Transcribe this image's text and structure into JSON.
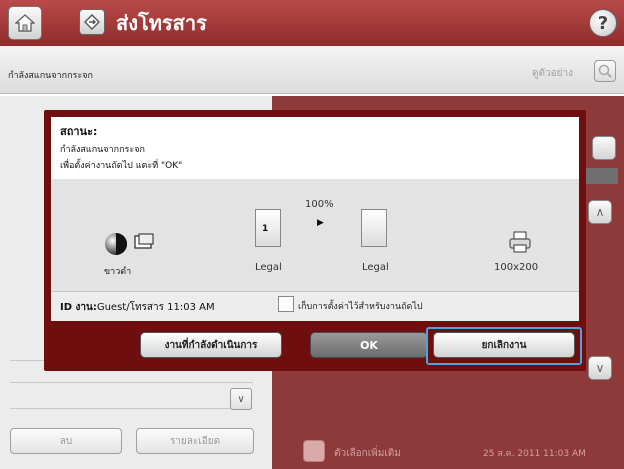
{
  "header": {
    "title": "ส่งโทรสาร",
    "home_icon": "home-icon",
    "fax_icon": "fax-send-icon",
    "help_icon": "help-icon",
    "help_glyph": "?"
  },
  "statusbar": {
    "status": "กำลังสแกนจากกระจก",
    "preview_label": "ดูตัวอย่าง"
  },
  "background": {
    "delete_label": "ลบ",
    "details_label": "รายละเอียด",
    "more_options_label": "ตัวเลือกเพิ่มเติม",
    "datetime": "25 ส.ค. 2011 11:03 AM"
  },
  "dialog": {
    "status_heading": "สถานะ:",
    "status_line1": "กำลังสแกนจากกระจก",
    "status_line2": "เพื่อตั้งค่างานถัดไป แตะที่ \"OK\"",
    "color_label": "ขาวดำ",
    "zoom_label": "100%",
    "page_number": "1",
    "original_size": "Legal",
    "output_size": "Legal",
    "paper_size": "100x200",
    "job_id_label": "ID งาน:",
    "job_id_value": "Guest/โทรสาร 11:03 AM",
    "keep_settings_label": "เก็บการตั้งค่าไว้สำหรับงานถัดไป",
    "keep_settings_checked": false,
    "buttons": {
      "current_jobs": "งานที่กำลังดำเนินการ",
      "ok": "OK",
      "cancel": "ยกเลิกงาน"
    }
  },
  "colors": {
    "header_red": "#9e3838",
    "dialog_border": "#6e0e0e",
    "focus_blue": "#4fa3d8"
  }
}
